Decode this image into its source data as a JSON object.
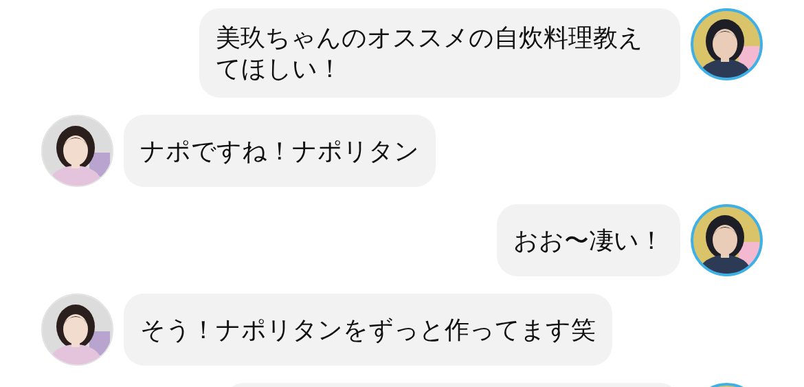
{
  "messages": [
    {
      "kind": "sent",
      "text": "美玖ちゃんのオススメの自炊料理教えてほしい！"
    },
    {
      "kind": "received",
      "text": "ナポですね！ナポリタン"
    },
    {
      "kind": "sent",
      "text": "おお〜凄い！"
    },
    {
      "kind": "received",
      "text": "そう！ナポリタンをずっと作ってます笑"
    },
    {
      "kind": "sent"
    }
  ]
}
